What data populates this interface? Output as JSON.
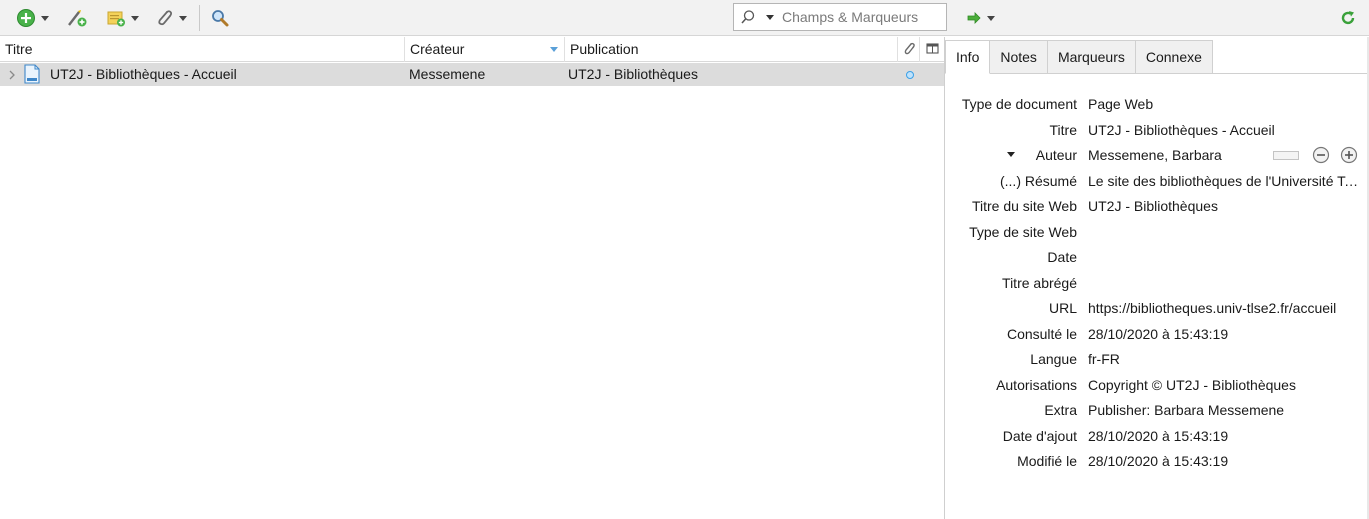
{
  "toolbar": {
    "search_placeholder": "Champs & Marqueurs",
    "icons": [
      "new-item-icon",
      "add-by-identifier-icon",
      "new-note-icon",
      "attachment-icon",
      "advanced-search-icon",
      "locate-icon",
      "sync-icon"
    ]
  },
  "columns": {
    "title": "Titre",
    "creator": "Créateur",
    "publication": "Publication"
  },
  "items": [
    {
      "title": "UT2J - Bibliothèques - Accueil",
      "creator": "Messemene",
      "publication": "UT2J - Bibliothèques"
    }
  ],
  "tabs": [
    "Info",
    "Notes",
    "Marqueurs",
    "Connexe"
  ],
  "info": {
    "fields": [
      {
        "label": "Type de document",
        "value": "Page Web"
      },
      {
        "label": "Titre",
        "value": "UT2J - Bibliothèques - Accueil"
      },
      {
        "label": "Auteur",
        "value": "Messemene, Barbara"
      },
      {
        "label": "(...) Résumé",
        "value": "Le site des bibliothèques de l'Université Toulouse - Jean Jaurès"
      },
      {
        "label": "Titre du site Web",
        "value": "UT2J - Bibliothèques"
      },
      {
        "label": "Type de site Web",
        "value": ""
      },
      {
        "label": "Date",
        "value": ""
      },
      {
        "label": "Titre abrégé",
        "value": ""
      },
      {
        "label": "URL",
        "value": "https://bibliotheques.univ-tlse2.fr/accueil"
      },
      {
        "label": "Consulté le",
        "value": "28/10/2020 à 15:43:19"
      },
      {
        "label": "Langue",
        "value": "fr-FR"
      },
      {
        "label": "Autorisations",
        "value": "Copyright © UT2J - Bibliothèques"
      },
      {
        "label": "Extra",
        "value": "Publisher: Barbara Messemene"
      },
      {
        "label": "Date d'ajout",
        "value": "28/10/2020 à 15:43:19"
      },
      {
        "label": "Modifié le",
        "value": "28/10/2020 à 15:43:19"
      }
    ]
  },
  "colors": {
    "selected_row": "#dcdcdc",
    "accent_green": "#3aa13a",
    "unread_dot": "#3aa0e8"
  }
}
